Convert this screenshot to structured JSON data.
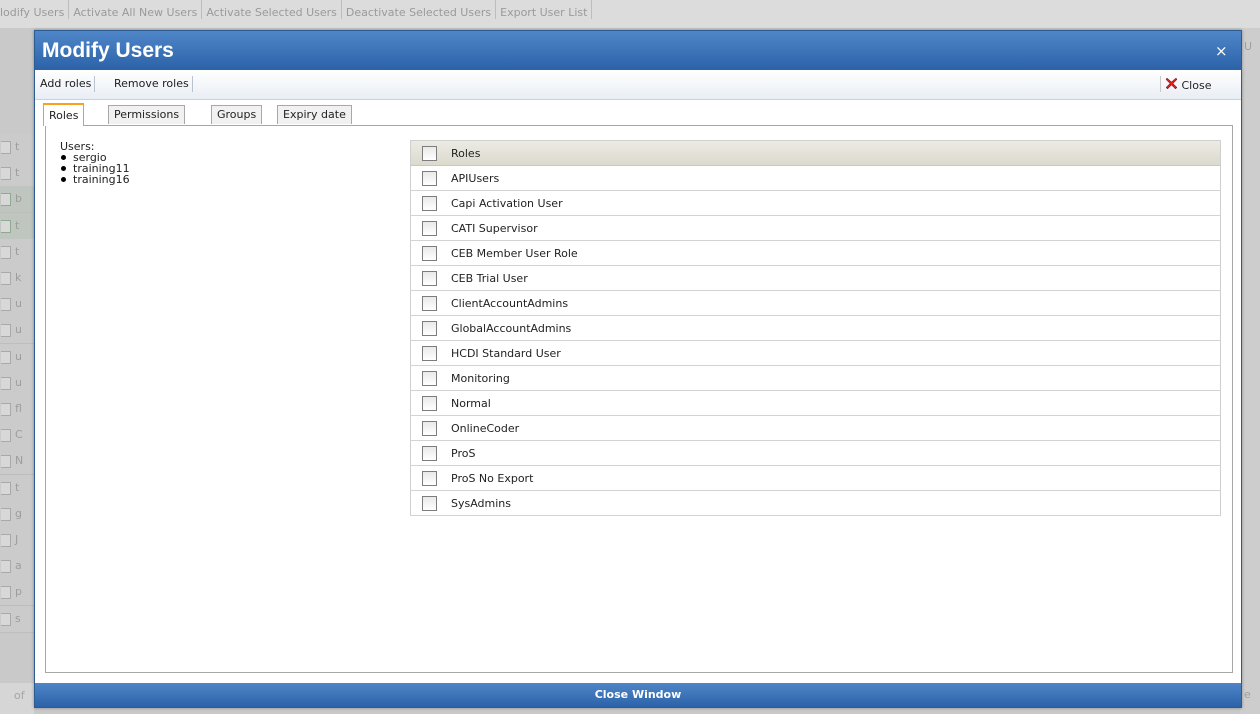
{
  "background": {
    "toolbar": [
      "lodify Users",
      "Activate All New Users",
      "Activate Selected Users",
      "Deactivate Selected Users",
      "Export User List"
    ],
    "rows": [
      "t",
      "t",
      "b",
      "t",
      "t",
      "k",
      "u",
      "u",
      "u",
      "u",
      "fl",
      "C",
      "N",
      "t",
      "g",
      "J",
      "a",
      "p",
      "s"
    ],
    "footer_left": "of",
    "right_glyphs": [
      "U",
      "e"
    ]
  },
  "modal": {
    "title": "Modify Users",
    "close_x": "×",
    "actions": {
      "add_roles": "Add roles",
      "remove_roles": "Remove roles",
      "close": "Close"
    },
    "tabs": [
      "Roles",
      "Permissions",
      "Groups",
      "Expiry date"
    ],
    "active_tab": "Roles",
    "users_label": "Users:",
    "users": [
      "sergio",
      "training11",
      "training16"
    ],
    "roles_header": "Roles",
    "roles": [
      "APIUsers",
      "Capi Activation User",
      "CATI Supervisor",
      "CEB Member User Role",
      "CEB Trial User",
      "ClientAccountAdmins",
      "GlobalAccountAdmins",
      "HCDI Standard User",
      "Monitoring",
      "Normal",
      "OnlineCoder",
      "ProS",
      "ProS No Export",
      "SysAdmins"
    ],
    "footer_button": "Close Window",
    "colors": {
      "title_bar": "#3f75b9",
      "tab_accent": "#f7a21d",
      "close_icon": "#d61f1f"
    }
  }
}
